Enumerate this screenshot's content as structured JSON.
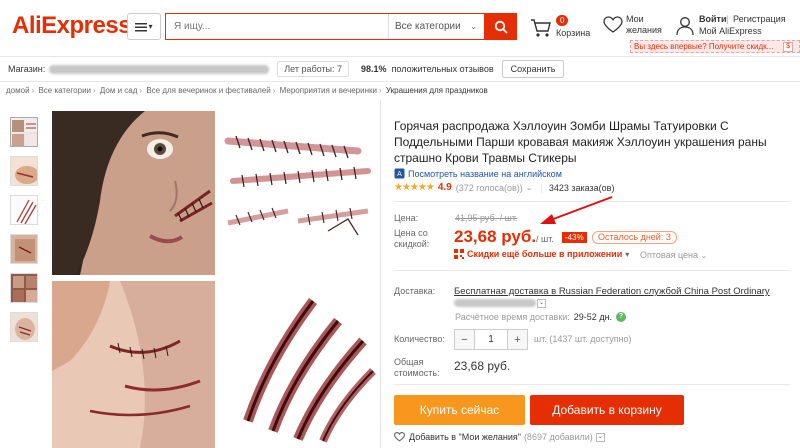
{
  "header": {
    "logo": "AliExpress",
    "logo_tm": "™",
    "search_placeholder": "Я ищу...",
    "category": "Все категории",
    "cart_count": "0",
    "cart_label": "Корзина",
    "wish_line1": "Мои",
    "wish_line2": "желания",
    "login": "Войти",
    "divider": "|",
    "register": "Регистрация",
    "my_account": "Мой AliExpress",
    "promo": "Вы здесь впервые? Получите скидк...",
    "promo_badge": "$"
  },
  "store": {
    "label": "Магазин:",
    "years": "Лет работы: 7",
    "positive_pct": "98.1%",
    "positive_text": "положительных отзывов",
    "save": "Сохранить"
  },
  "breadcrumb": [
    "домой",
    "Все категории",
    "Дом и сад",
    "Все для вечеринок и фестивалей",
    "Мероприятия и вечеринки",
    "Украшения для праздников"
  ],
  "product": {
    "title": "Горячая распродажа Хэллоуин Зомби Шрамы Татуировки С Поддельными Парши кровавая макияж Хэллоуин украшения раны страшно Крови Травмы Стикеры",
    "translate": "Посмотреть название на английском",
    "stars": "★★★★★",
    "rating": "4.9",
    "votes": "(372 голоса(ов))",
    "orders": "3423 заказа(ов)",
    "price_label": "Цена:",
    "orig_price": "41,95 руб. / шт.",
    "disc_label_1": "Цена со",
    "disc_label_2": "скидкой:",
    "price": "23,68 руб.",
    "unit": "/ шт.",
    "discount": "-43%",
    "days_left": "Осталось дней: 3",
    "app_promo": "Скидки ещё больше в приложении",
    "wholesale": "Оптовая цена",
    "delivery_label": "Доставка:",
    "delivery_text": "Бесплатная доставка в Russian Federation службой China Post Ordinary",
    "delivery_time_label": "Расчётное время доставки:",
    "delivery_time": "29-52 дн.",
    "qty_label": "Количество:",
    "qty": "1",
    "qty_note": "шт. (1437 шт. доступно)",
    "total_label_1": "Общая",
    "total_label_2": "стоимость:",
    "total": "23,68 руб.",
    "buy": "Купить сейчас",
    "add_cart": "Добавить в корзину",
    "wishlist": "Добавить в \"Мои желания\"",
    "wish_count": "(8697 добавили)"
  },
  "colors": {
    "brand": "#e62e04",
    "buy": "#f7971e",
    "star": "#f5a623",
    "link": "#2155a5"
  }
}
